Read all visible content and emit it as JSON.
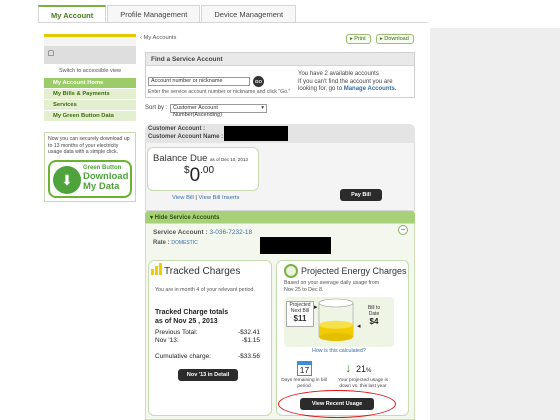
{
  "tabs": [
    {
      "label": "My Account",
      "active": true
    },
    {
      "label": "Profile Management",
      "active": false
    },
    {
      "label": "Device Management",
      "active": false
    }
  ],
  "sidebar": {
    "access_text": "Switch to accessible view",
    "items": [
      {
        "label": "My Account Home",
        "selected": true
      },
      {
        "label": "My Bills & Payments",
        "selected": false
      },
      {
        "label": "Services",
        "selected": false
      },
      {
        "label": "My Green Button Data",
        "selected": false
      }
    ],
    "green_button": {
      "text": "Now you can securely download up to 13 months of your electricity usage data with a simple click.",
      "logo_line1": "Green Button",
      "logo_line2": "Download",
      "logo_line3": "My Data"
    }
  },
  "breadcrumb": "‹ My Accounts",
  "toolbar": {
    "print": "Print",
    "download": "Download"
  },
  "find_account": {
    "title": "Find a Service Account",
    "input_value": "Account number or nickname",
    "go": "GO",
    "hint": "Enter the service account number or nickname and click \"Go.\"",
    "available_line1": "You have 2 available accounts",
    "available_line2": "If you can't find the account you are",
    "available_line3_prefix": "looking for, go to",
    "available_link": "Manage Accounts."
  },
  "sort": {
    "label": "Sort by :",
    "selected": "Customer Account Number(Ascending)"
  },
  "customer": {
    "account_label": "Customer Account :",
    "account_name_label": "Customer Account Name :",
    "balance_title": "Balance Due",
    "balance_date": "as of Dec 10, 2013",
    "balance_currency": "$",
    "balance_whole": "0",
    "balance_cents": "00",
    "view_bill": "View Bill",
    "view_bill_inserts": "View Bill Inserts",
    "pay_bill": "Pay Bill"
  },
  "service_accounts": {
    "toggle": "▾ Hide Service Accounts",
    "account_label": "Service Account :",
    "account_number": "3-036-7232-18",
    "rate_label": "Rate :",
    "rate_value": "DOMESTIC"
  },
  "tracked": {
    "title": "Tracked Charges",
    "month_text": "You are in month 4 of your relevant period.",
    "totals_line1": "Tracked Charge totals",
    "totals_line2": "as of Nov 25 , 2013",
    "previous_label": "Previous Total:",
    "previous_value": "-$32.41",
    "nov_label": "Nov '13:",
    "nov_value": "-$1.15",
    "cumulative_label": "Cumulative charge:",
    "cumulative_value": "-$33.56",
    "detail_button": "Nov '13 in Detail"
  },
  "projected": {
    "title": "Projected Energy Charges",
    "subtitle": "Based on your average daily usage from Nov 25 to Dec 8.",
    "next_bill_label": "Projected Next Bill",
    "next_bill_value": "$11",
    "to_date_label": "Bill to Date",
    "to_date_value": "$4",
    "fill_fraction": 0.36,
    "calc_link": "How is this calculated?",
    "days_value": "17",
    "days_label": "Days remaining in bill period",
    "pct_value": "21",
    "pct_sign": "%",
    "pct_label": "Your projected usage is down vs. this last year",
    "recent_button": "View Recent Usage"
  },
  "colors": {
    "brand_green": "#7ab241",
    "dark_button": "#2b2b2b",
    "gold": "#f0cc00",
    "highlight_ring": "#dd1111"
  }
}
